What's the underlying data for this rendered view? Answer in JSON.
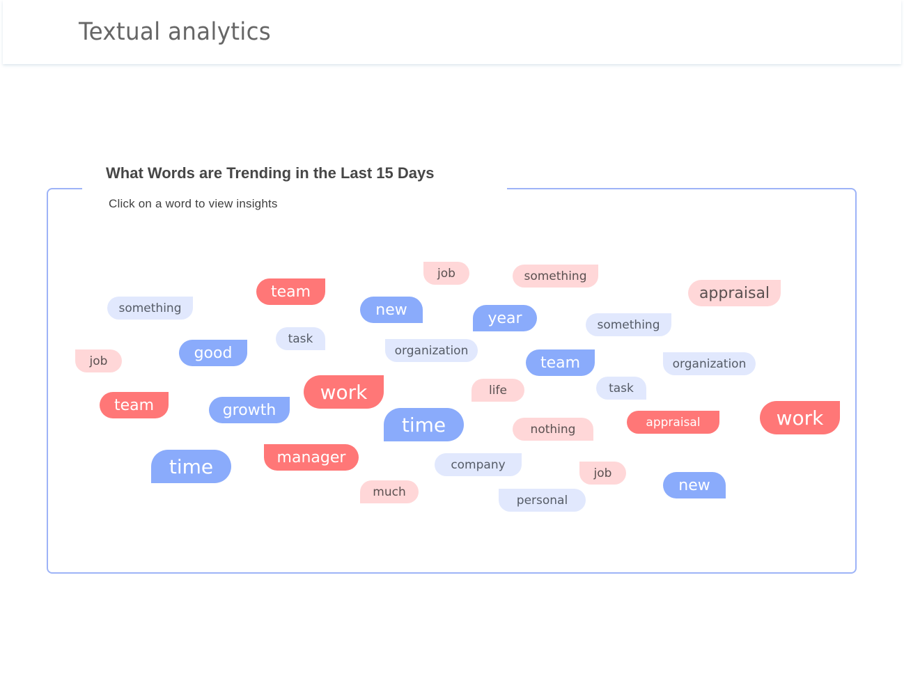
{
  "header": {
    "title": "Textual analytics"
  },
  "panel": {
    "title": "What Words are Trending in the Last 15 Days",
    "subtitle": "Click on a word to view insights"
  },
  "colors": {
    "accent_blue": "#8aabfb",
    "light_blue": "#e1e8fd",
    "accent_red": "#ff7777",
    "light_pink": "#ffd7d8",
    "panel_border": "#9db3f7"
  },
  "words": [
    {
      "text": "something",
      "tone": "lb",
      "size": "s",
      "corner": "tr"
    },
    {
      "text": "team",
      "tone": "rd",
      "size": "m",
      "corner": "tr"
    },
    {
      "text": "task",
      "tone": "lb",
      "size": "s",
      "corner": "br"
    },
    {
      "text": "good",
      "tone": "bl",
      "size": "m",
      "corner": "tr"
    },
    {
      "text": "job",
      "tone": "pk",
      "size": "s",
      "corner": "tl"
    },
    {
      "text": "job",
      "tone": "pk",
      "size": "s",
      "corner": "tl"
    },
    {
      "text": "something",
      "tone": "pk",
      "size": "s",
      "corner": "tr"
    },
    {
      "text": "new",
      "tone": "bl",
      "size": "m",
      "corner": "br"
    },
    {
      "text": "year",
      "tone": "bl",
      "size": "m",
      "corner": "bll"
    },
    {
      "text": "organization",
      "tone": "lb",
      "size": "s",
      "corner": "tl"
    },
    {
      "text": "team",
      "tone": "bl",
      "size": "m",
      "corner": "tr"
    },
    {
      "text": "appraisal",
      "tone": "pk",
      "size": "m",
      "corner": "tr"
    },
    {
      "text": "something",
      "tone": "lb",
      "size": "s",
      "corner": "tr"
    },
    {
      "text": "organization",
      "tone": "lb",
      "size": "s",
      "corner": "tl"
    },
    {
      "text": "task",
      "tone": "lb",
      "size": "s",
      "corner": "br"
    },
    {
      "text": "appraisal",
      "tone": "rd",
      "size": "s",
      "corner": "tr"
    },
    {
      "text": "work",
      "tone": "rd",
      "size": "l",
      "corner": "tr"
    },
    {
      "text": "team",
      "tone": "rd",
      "size": "m",
      "corner": "tr"
    },
    {
      "text": "growth",
      "tone": "bl",
      "size": "m",
      "corner": "tr"
    },
    {
      "text": "work",
      "tone": "rd",
      "size": "l",
      "corner": "tr"
    },
    {
      "text": "time",
      "tone": "bl",
      "size": "l",
      "corner": "bll"
    },
    {
      "text": "manager",
      "tone": "rd",
      "size": "m",
      "corner": "tl"
    },
    {
      "text": "much",
      "tone": "pk",
      "size": "s",
      "corner": "bll"
    },
    {
      "text": "life",
      "tone": "pk",
      "size": "s",
      "corner": "bll"
    },
    {
      "text": "time",
      "tone": "bl",
      "size": "l",
      "corner": "bll"
    },
    {
      "text": "nothing",
      "tone": "pk",
      "size": "s",
      "corner": "br"
    },
    {
      "text": "company",
      "tone": "lb",
      "size": "s",
      "corner": "tr"
    },
    {
      "text": "job",
      "tone": "pk",
      "size": "s",
      "corner": "tl"
    },
    {
      "text": "personal",
      "tone": "lb",
      "size": "s",
      "corner": "tl"
    },
    {
      "text": "new",
      "tone": "bl",
      "size": "m",
      "corner": "br"
    }
  ]
}
